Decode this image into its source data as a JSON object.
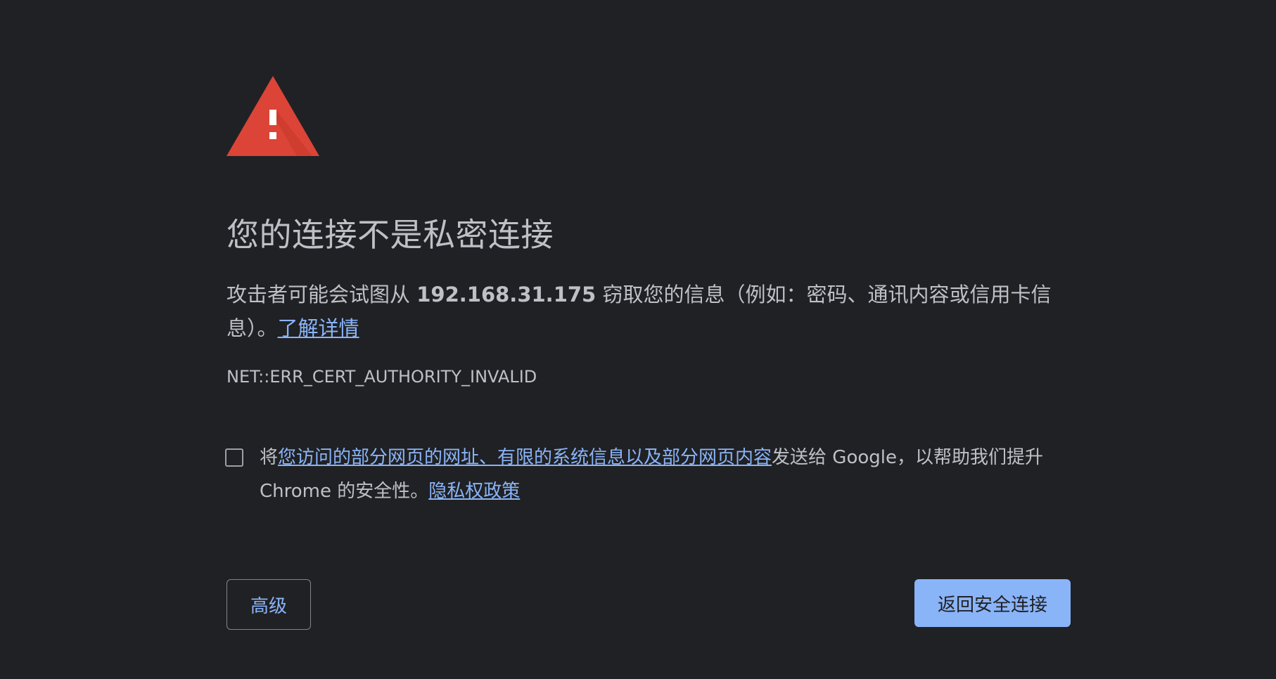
{
  "title": "您的连接不是私密连接",
  "description": {
    "prefix": "攻击者可能会试图从 ",
    "host": "192.168.31.175",
    "suffix": " 窃取您的信息（例如：密码、通讯内容或信用卡信息）。",
    "learn_more_link": "了解详情"
  },
  "error_code": "NET::ERR_CERT_AUTHORITY_INVALID",
  "report": {
    "checked": false,
    "prefix": "将",
    "link": "您访问的部分网页的网址、有限的系统信息以及部分网页内容",
    "middle": "发送给 Google，以帮助我们提升 Chrome 的安全性。",
    "privacy_link": "隐私权政策"
  },
  "buttons": {
    "advanced": "高级",
    "back_to_safety": "返回安全连接"
  },
  "colors": {
    "background": "#202124",
    "text": "#bdc1c6",
    "link": "#8ab4f8",
    "warning": "#db4437",
    "primary_button": "#8ab4f8"
  },
  "icons": {
    "warning": "warning-triangle-icon"
  }
}
